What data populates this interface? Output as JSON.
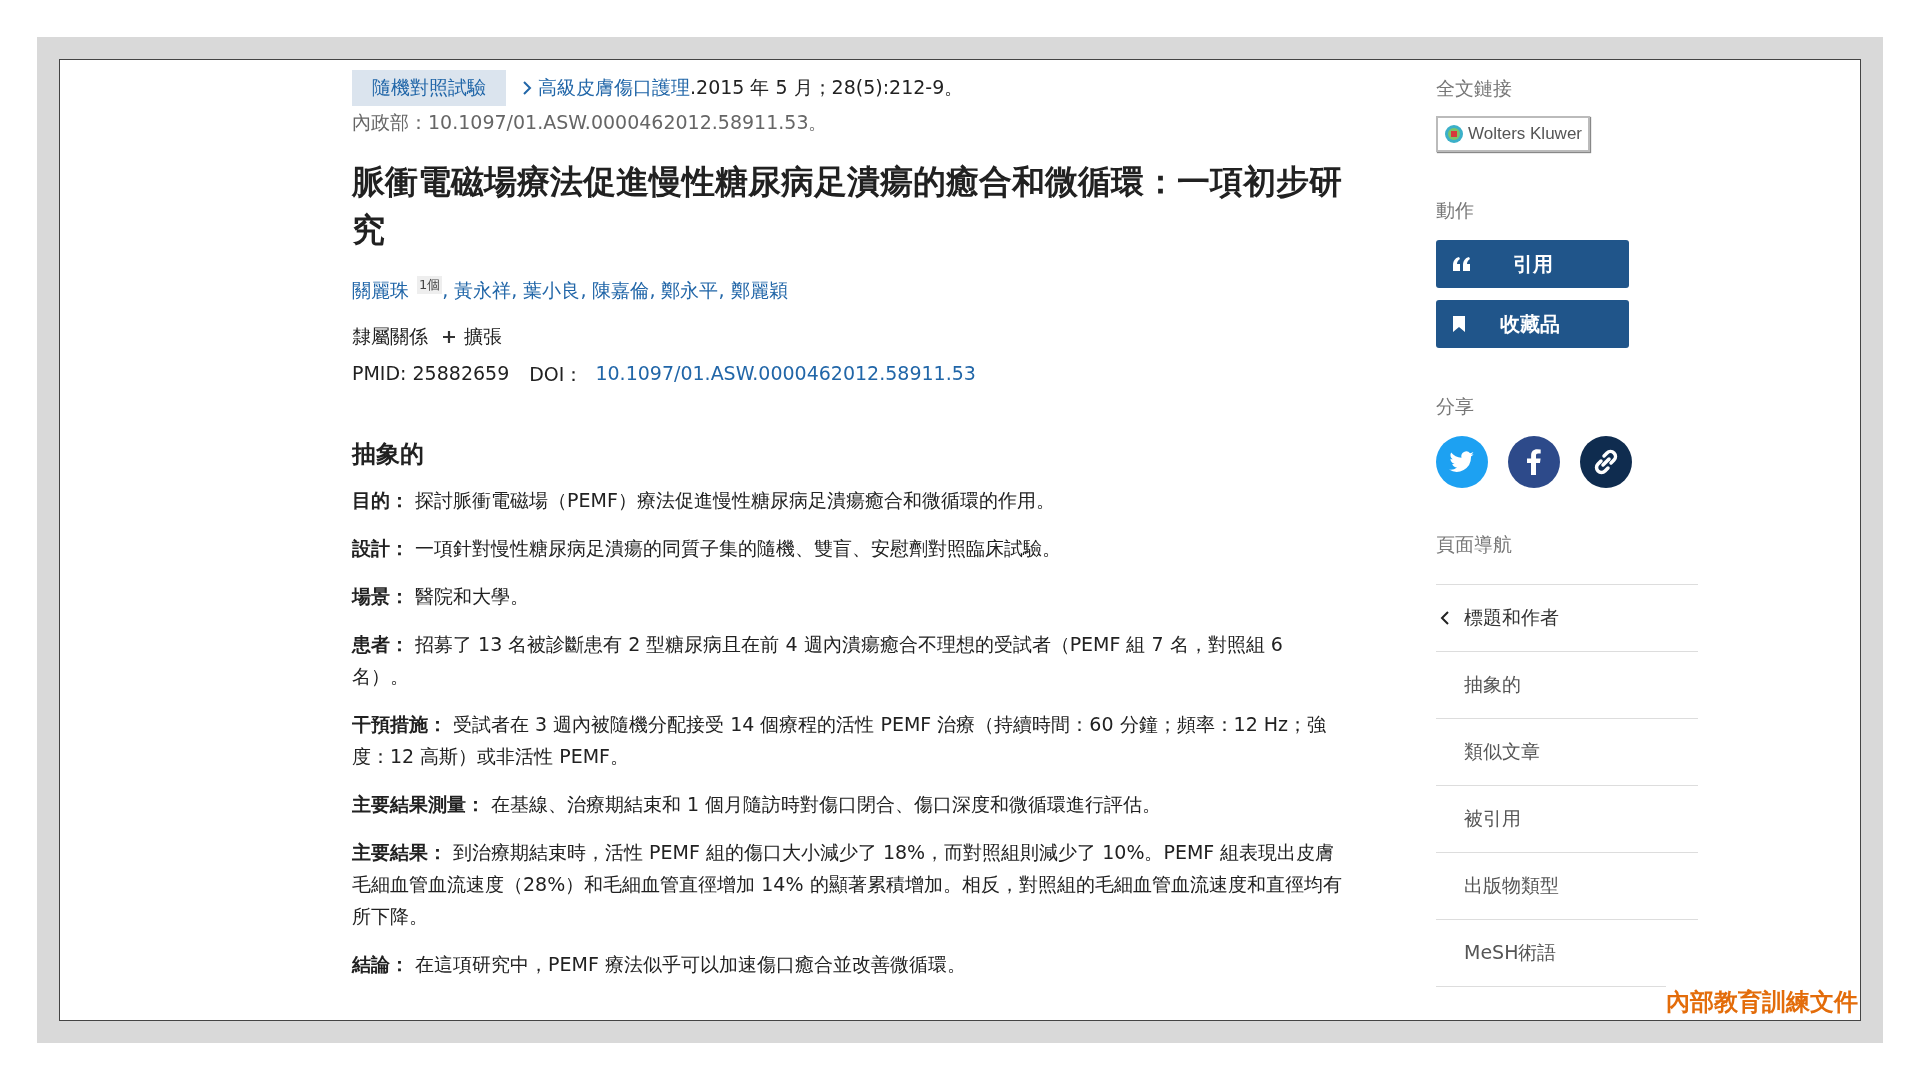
{
  "article_type": "隨機對照試驗",
  "citation": {
    "journal": "高級皮膚傷口護理",
    "details": ".2015 年 5 月；28(5):212-9。"
  },
  "doi_line": "內政部：10.1097/01.ASW.0000462012.58911.53。",
  "title": "脈衝電磁場療法促進慢性糖尿病足潰瘍的癒合和微循環：一項初步研究",
  "authors": [
    {
      "name": "關麗珠",
      "note": "1個",
      "sep": ","
    },
    {
      "name": "黃永祥,"
    },
    {
      "name": "葉小良,"
    },
    {
      "name": "陳嘉倫,"
    },
    {
      "name": "鄭永平,"
    },
    {
      "name": "鄭麗穎"
    }
  ],
  "affiliations": {
    "label": "隸屬關係",
    "toggle": "擴張"
  },
  "identifiers": {
    "pmid_label": "PMID: 25882659",
    "doi_label": "DOI：",
    "doi": "10.1097/01.ASW.0000462012.58911.53"
  },
  "abstract": {
    "heading": "抽象的",
    "sections": [
      {
        "label": "目的：",
        "text": "探討脈衝電磁場（PEMF）療法促進慢性糖尿病足潰瘍癒合和微循環的作用。"
      },
      {
        "label": "設計：",
        "text": "一項針對慢性糖尿病足潰瘍的同質子集的隨機、雙盲、安慰劑對照臨床試驗。"
      },
      {
        "label": "場景：",
        "text": "醫院和大學。"
      },
      {
        "label": "患者：",
        "text": "招募了 13 名被診斷患有 2 型糖尿病且在前 4 週內潰瘍癒合不理想的受試者（PEMF 組 7 名，對照組 6 名）。"
      },
      {
        "label": "干預措施：",
        "text": "受試者在 3 週內被隨機分配接受 14 個療程的活性 PEMF 治療（持續時間：60 分鐘；頻率：12 Hz；強度：12 高斯）或非活性 PEMF。"
      },
      {
        "label": "主要結果測量：",
        "text": "在基線、治療期結束和 1 個月隨訪時對傷口閉合、傷口深度和微循環進行評估。"
      },
      {
        "label": "主要結果：",
        "text": "到治療期結束時，活性 PEMF 組的傷口大小減少了 18%，而對照組則減少了 10%。PEMF 組表現出皮膚毛細血管血流速度（28%）和毛細血管直徑增加 14% 的顯著累積增加。相反，對照組的毛細血管血流速度和直徑均有所下降。"
      },
      {
        "label": "結論：",
        "text": "在這項研究中，PEMF 療法似乎可以加速傷口癒合並改善微循環。"
      }
    ]
  },
  "sidebar": {
    "full_text_heading": "全文鏈接",
    "publisher": "Wolters Kluwer",
    "actions_heading": "動作",
    "actions": [
      {
        "kind": "cite",
        "label": "引用"
      },
      {
        "kind": "collect",
        "label": "收藏品"
      }
    ],
    "share_heading": "分享",
    "share": [
      {
        "kind": "twitter"
      },
      {
        "kind": "facebook"
      },
      {
        "kind": "link"
      }
    ],
    "nav_heading": "頁面導航",
    "nav": [
      {
        "label": "標題和作者",
        "selected": true
      },
      {
        "label": "抽象的",
        "selected": false
      },
      {
        "label": "類似文章",
        "selected": false
      },
      {
        "label": "被引用",
        "selected": false
      },
      {
        "label": "出版物類型",
        "selected": false
      },
      {
        "label": "MeSH術語",
        "selected": false
      }
    ]
  },
  "document_label": "內部教育訓練文件"
}
